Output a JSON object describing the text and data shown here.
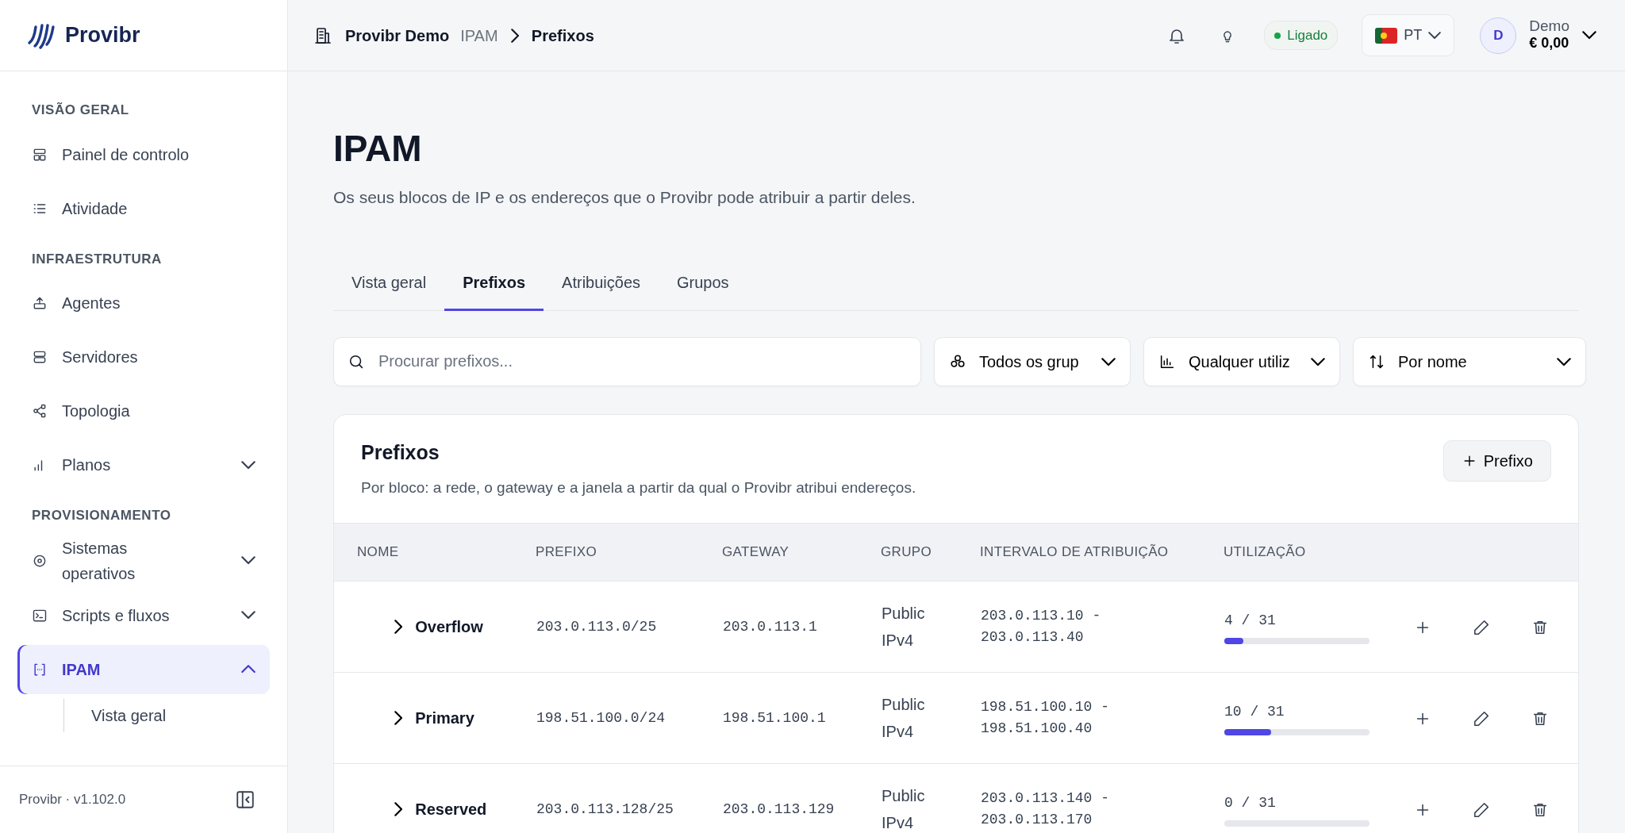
{
  "brand": {
    "name": "Provibr"
  },
  "sidebar": {
    "items": [
      {
        "kind": "heading",
        "label": "VISÃO GERAL"
      },
      {
        "kind": "link",
        "label": "Painel de controlo",
        "selected": false
      },
      {
        "kind": "link",
        "label": "Atividade",
        "selected": false
      },
      {
        "kind": "heading",
        "label": "INFRAESTRUTURA"
      },
      {
        "kind": "link",
        "label": "Agentes",
        "selected": false
      },
      {
        "kind": "link",
        "label": "Servidores",
        "selected": false
      },
      {
        "kind": "link",
        "label": "Topologia",
        "selected": false
      },
      {
        "kind": "group",
        "label": "Planos",
        "selected": false,
        "expanded": false
      },
      {
        "kind": "heading",
        "label": "PROVISIONAMENTO"
      },
      {
        "kind": "group",
        "label": "Sistemas operativos",
        "selected": false,
        "expanded": false
      },
      {
        "kind": "group",
        "label": "Scripts e fluxos",
        "selected": false,
        "expanded": false
      },
      {
        "kind": "group",
        "label": "IPAM",
        "selected": true,
        "expanded": true,
        "children": [
          {
            "label": "Vista geral",
            "selected": false
          }
        ]
      }
    ],
    "footer": {
      "version": "Provibr · v1.102.0"
    }
  },
  "header": {
    "breadcrumb": [
      "Provibr Demo",
      "IPAM",
      "Prefixos"
    ],
    "status": {
      "label": "Ligado",
      "color": "#16a34a"
    },
    "language": "PT",
    "user": {
      "initial": "D",
      "name": "Demo",
      "balance": "€ 0,00"
    }
  },
  "page": {
    "title": "IPAM",
    "subtitle": "Os seus blocos de IP e os endereços que o Provibr pode atribuir a partir deles."
  },
  "tabs": [
    {
      "label": "Vista geral",
      "selected": false
    },
    {
      "label": "Prefixos",
      "selected": true
    },
    {
      "label": "Atribuições",
      "selected": false
    },
    {
      "label": "Grupos",
      "selected": false
    }
  ],
  "filters": {
    "search": {
      "placeholder": "Procurar prefixos..."
    },
    "dropdowns": [
      {
        "value": "Todos os grup"
      },
      {
        "value": "Qualquer utiliz"
      },
      {
        "value": "Por nome"
      }
    ]
  },
  "card": {
    "title": "Prefixos",
    "description": "Por bloco: a rede, o gateway e a janela a partir da qual o Provibr atribui endereços.",
    "add_button": "Prefixo"
  },
  "table": {
    "columns": [
      "NOME",
      "PREFIXO",
      "GATEWAY",
      "GRUPO",
      "INTERVALO DE ATRIBUIÇÃO",
      "UTILIZAÇÃO"
    ],
    "rows": [
      {
        "name": "Overflow",
        "expanded": false,
        "prefix": "203.0.113.0/25",
        "gateway": "203.0.113.1",
        "group": "Public IPv4",
        "range": "203.0.113.10 - 203.0.113.40",
        "usage": "4 / 31",
        "level": 0.129
      },
      {
        "name": "Primary",
        "expanded": false,
        "prefix": "198.51.100.0/24",
        "gateway": "198.51.100.1",
        "group": "Public IPv4",
        "range": "198.51.100.10 - 198.51.100.40",
        "usage": "10 / 31",
        "level": 0.323
      },
      {
        "name": "Reserved",
        "expanded": false,
        "prefix": "203.0.113.128/25",
        "gateway": "203.0.113.129",
        "group": "Public IPv4",
        "range": "203.0.113.140 - 203.0.113.170",
        "usage": "0 / 31",
        "level": 0
      }
    ]
  }
}
